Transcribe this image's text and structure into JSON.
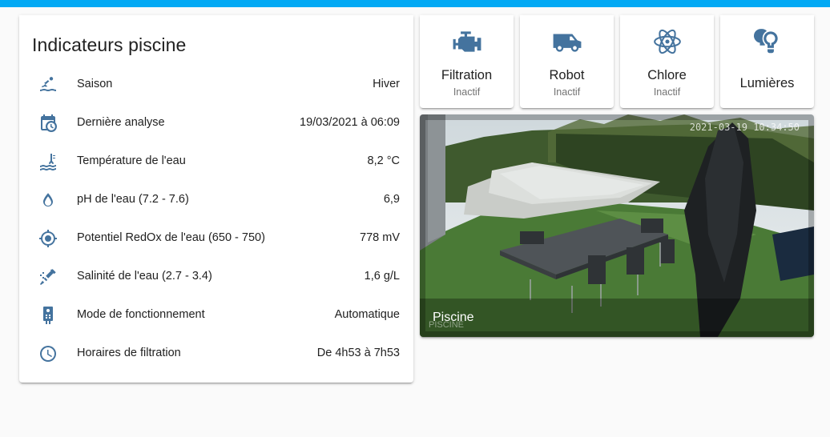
{
  "colors": {
    "accent": "#03a9f4",
    "icon": "#44739e"
  },
  "indicators": {
    "title": "Indicateurs piscine",
    "rows": [
      {
        "icon": "swim-icon",
        "name": "Saison",
        "state": "Hiver"
      },
      {
        "icon": "calendar-clock-icon",
        "name": "Dernière analyse",
        "state": "19/03/2021 à 06:09"
      },
      {
        "icon": "water-thermometer-icon",
        "name": "Température de l'eau",
        "state": "8,2 °C"
      },
      {
        "icon": "water-drop-icon",
        "name": "pH de l'eau (7.2 - 7.6)",
        "state": "6,9"
      },
      {
        "icon": "target-icon",
        "name": "Potentiel RedOx de l'eau (650 - 750)",
        "state": "778 mV"
      },
      {
        "icon": "salt-shaker-icon",
        "name": "Salinité de l'eau (2.7 - 3.4)",
        "state": "1,6 g/L"
      },
      {
        "icon": "remote-icon",
        "name": "Mode de fonctionnement",
        "state": "Automatique"
      },
      {
        "icon": "clock-icon",
        "name": "Horaires de filtration",
        "state": "De 4h53 à 7h53"
      }
    ]
  },
  "buttons": [
    {
      "icon": "engine-icon",
      "label": "Filtration",
      "state": "Inactif"
    },
    {
      "icon": "van-icon",
      "label": "Robot",
      "state": "Inactif"
    },
    {
      "icon": "atom-icon",
      "label": "Chlore",
      "state": "Inactif"
    },
    {
      "icon": "lightbulbs-icon",
      "label": "Lumières",
      "state": ""
    }
  ],
  "camera": {
    "title": "Piscine",
    "overlay_label": "PISCINE",
    "timestamp": "2021-03-19 10:34:50"
  }
}
